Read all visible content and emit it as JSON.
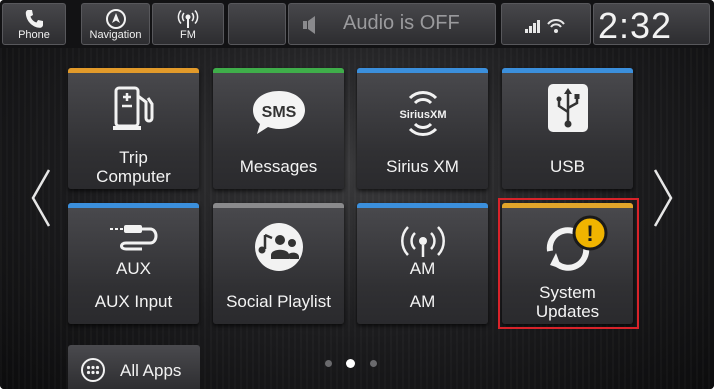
{
  "status_bar": {
    "phone_label": "Phone",
    "navigation_label": "Navigation",
    "fm_label": "FM",
    "audio_status": "Audio is OFF",
    "clock": "2:32"
  },
  "tiles": [
    {
      "label_line1": "Trip",
      "label_line2": "Computer",
      "accent": "#e29a2a",
      "icon": "fuel-pump-icon"
    },
    {
      "label_line1": "Messages",
      "accent": "#3fae4a",
      "icon": "sms-icon",
      "icon_text": "SMS"
    },
    {
      "label_line1": "Sirius XM",
      "accent": "#3b8fdc",
      "icon": "siriusxm-icon",
      "icon_text": "SiriusXM"
    },
    {
      "label_line1": "USB",
      "accent": "#3b8fdc",
      "icon": "usb-icon"
    },
    {
      "label_line1": "AUX",
      "label_line2": "AUX Input",
      "accent": "#3b8fdc",
      "icon": "aux-cable-icon"
    },
    {
      "label_line1": "Social Playlist",
      "accent": "#8a8a8c",
      "icon": "social-playlist-icon"
    },
    {
      "label_line1": "AM",
      "label_line2": "AM",
      "accent": "#3b8fdc",
      "icon": "am-antenna-icon"
    },
    {
      "label_line1": "System",
      "label_line2": "Updates",
      "accent": "#e2a52a",
      "icon": "refresh-icon",
      "alert": "!"
    }
  ],
  "bottom": {
    "all_apps_label": "All Apps",
    "page_indicator": {
      "current": 2,
      "total": 3
    }
  },
  "colors": {
    "highlight_border": "#d8232a",
    "alert_badge": "#f0b400"
  }
}
